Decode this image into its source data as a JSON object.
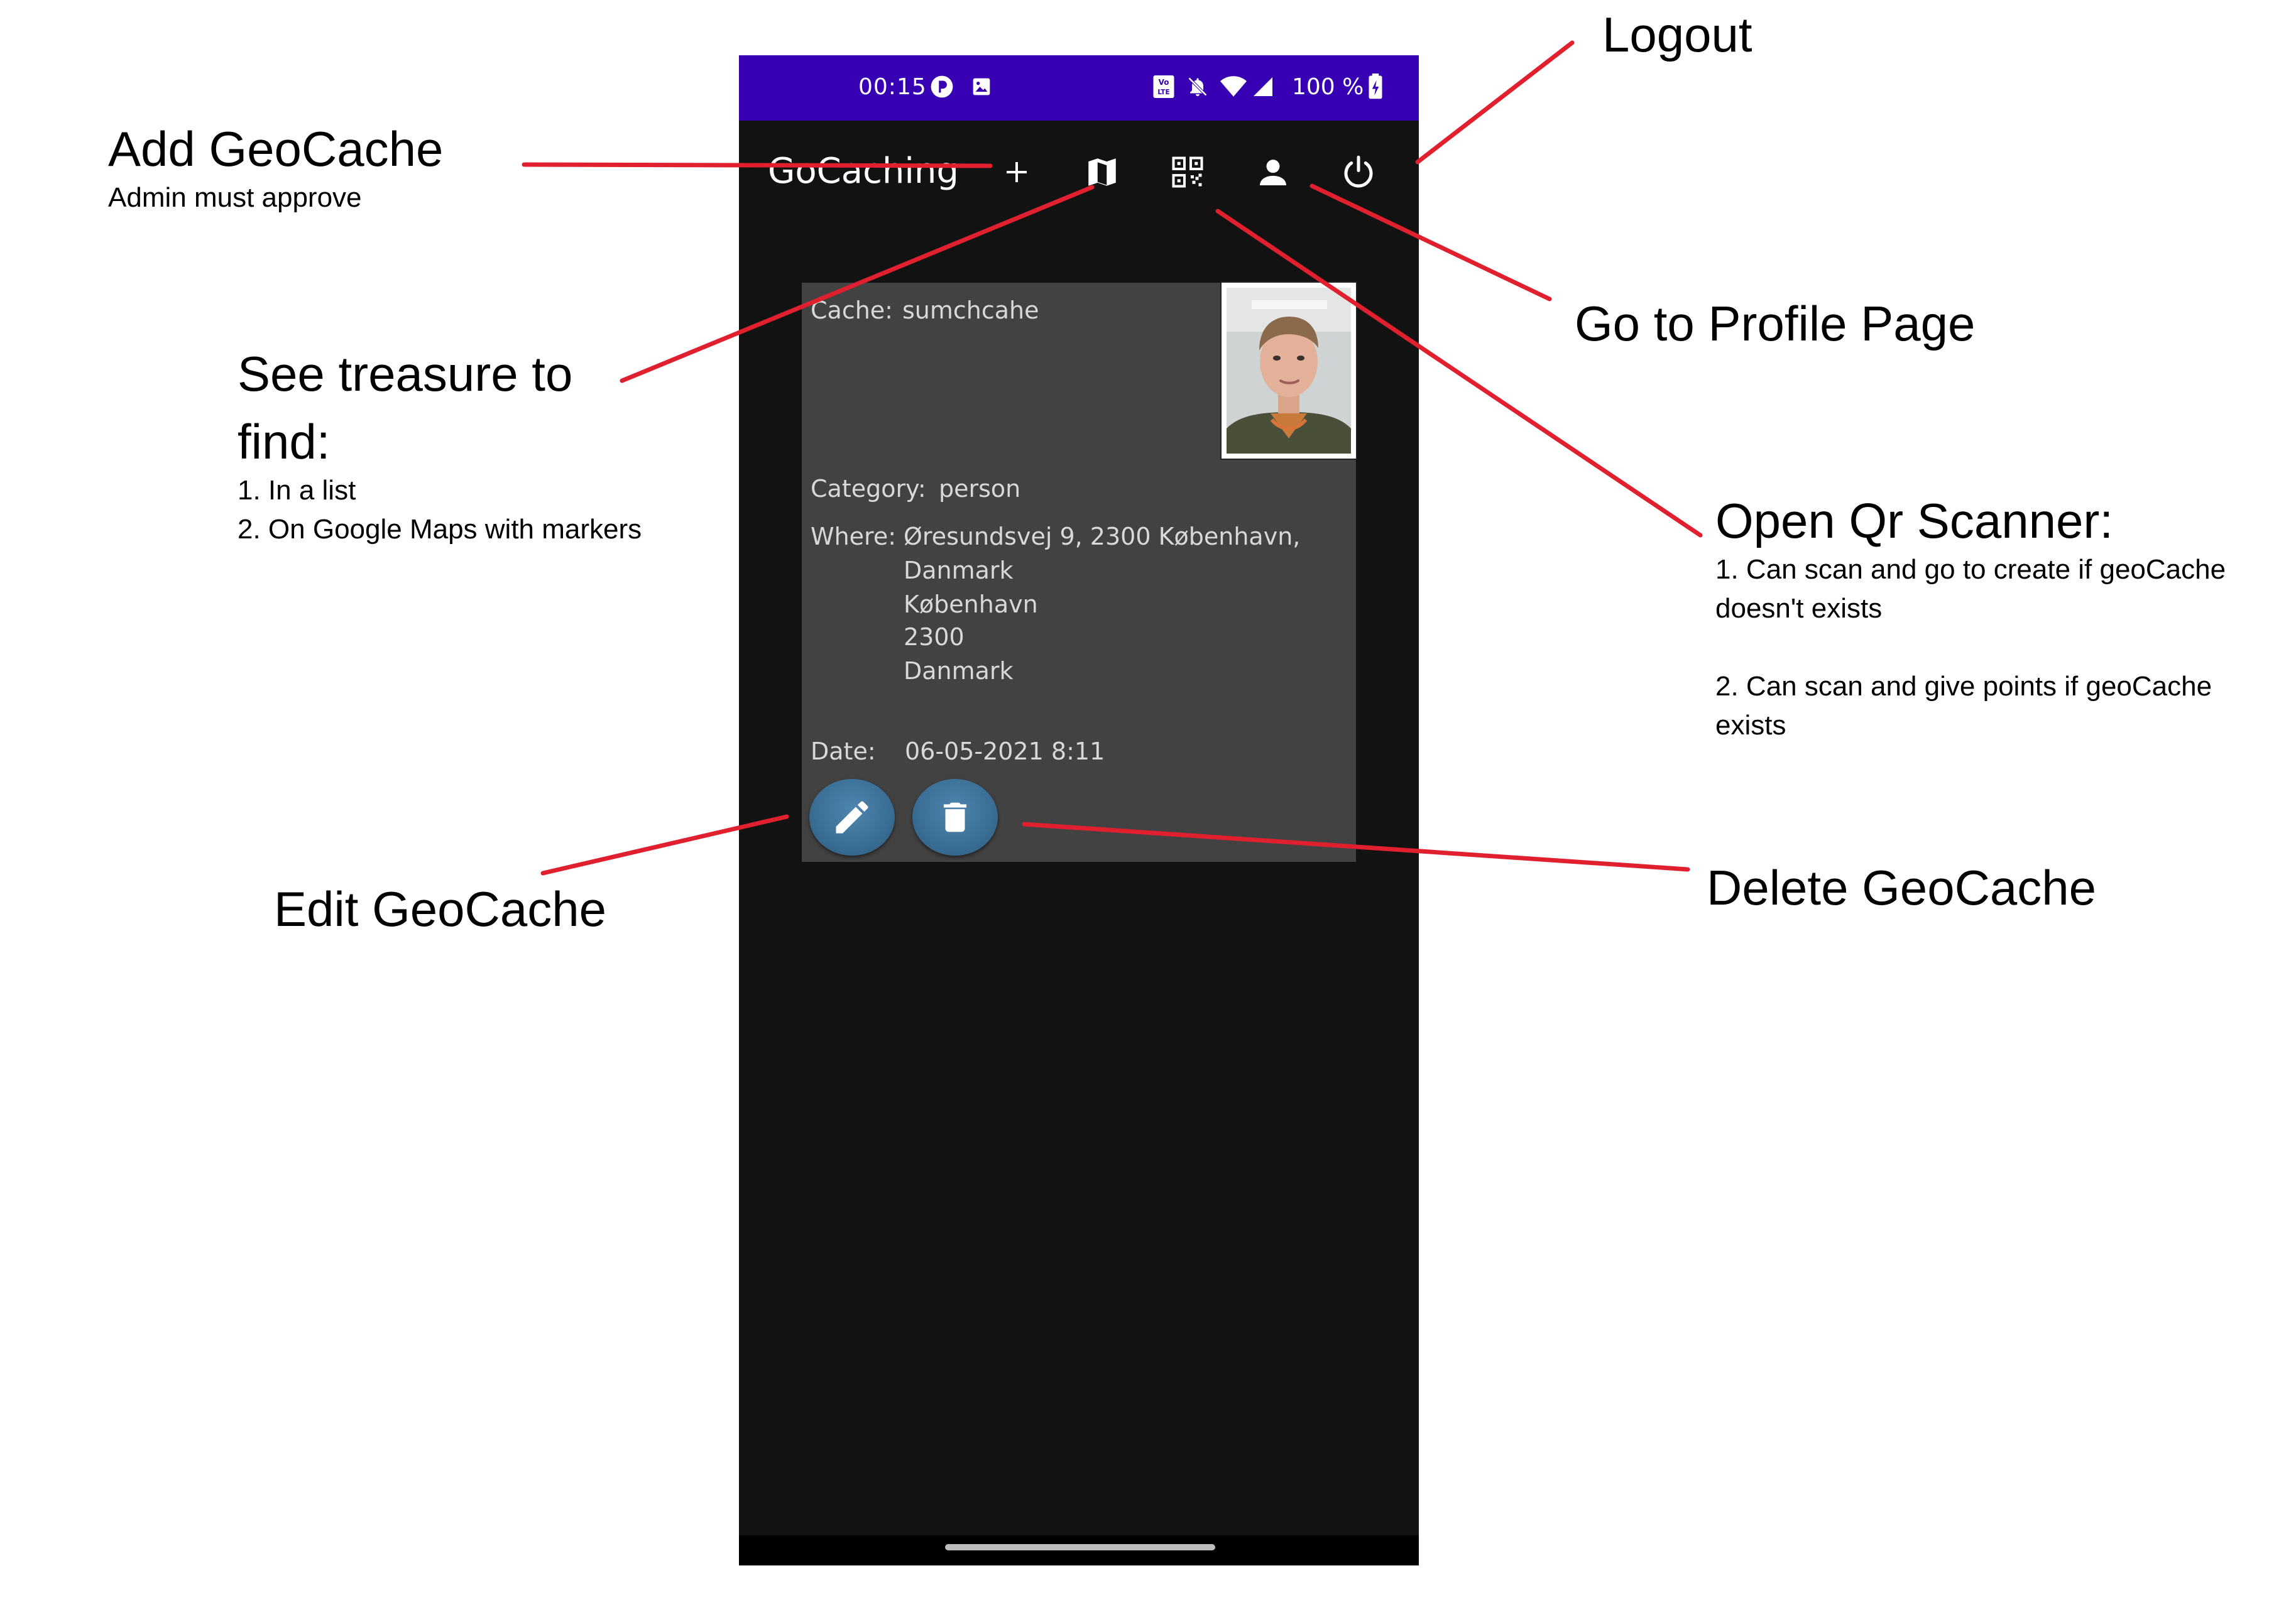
{
  "status_bar": {
    "time": "00:15",
    "battery": "100 %"
  },
  "app_bar": {
    "title": "GoCaching",
    "actions": [
      {
        "name": "add-icon"
      },
      {
        "name": "map-icon"
      },
      {
        "name": "qr-code-icon"
      },
      {
        "name": "person-icon"
      },
      {
        "name": "power-icon"
      }
    ]
  },
  "cache_card": {
    "cache_label": "Cache:",
    "cache_value": "sumchcahe",
    "category_label": "Category:",
    "category_value": "person",
    "where_label": "Where:",
    "where_lines": [
      "Øresundsvej 9, 2300 København,",
      "Danmark",
      "København",
      "2300",
      "Danmark"
    ],
    "date_label": "Date:",
    "date_value": "06-05-2021 8:11",
    "edit_icon": "pencil-icon",
    "delete_icon": "trash-icon"
  },
  "annotations": {
    "logout": {
      "title": "Logout"
    },
    "add_geocache": {
      "title": "Add GeoCache",
      "sub": "Admin must approve"
    },
    "profile": {
      "title": "Go to Profile Page"
    },
    "treasure": {
      "title_line1": "See treasure to",
      "title_line2": "find:",
      "item1": "1. In a list",
      "item2": "2. On Google Maps with markers"
    },
    "qr": {
      "title": "Open Qr Scanner:",
      "line1": "1. Can scan and go to create if geoCache",
      "line2": "doesn't exists",
      "line3": "2. Can scan and give points if geoCache",
      "line4": "exists"
    },
    "edit": {
      "title": "Edit GeoCache"
    },
    "delete": {
      "title": "Delete GeoCache"
    }
  },
  "colors": {
    "status_bar": "#3700b3",
    "background": "#121212",
    "card": "#424242",
    "fab": "#3a6e95",
    "annotation_line": "#e0202e"
  }
}
